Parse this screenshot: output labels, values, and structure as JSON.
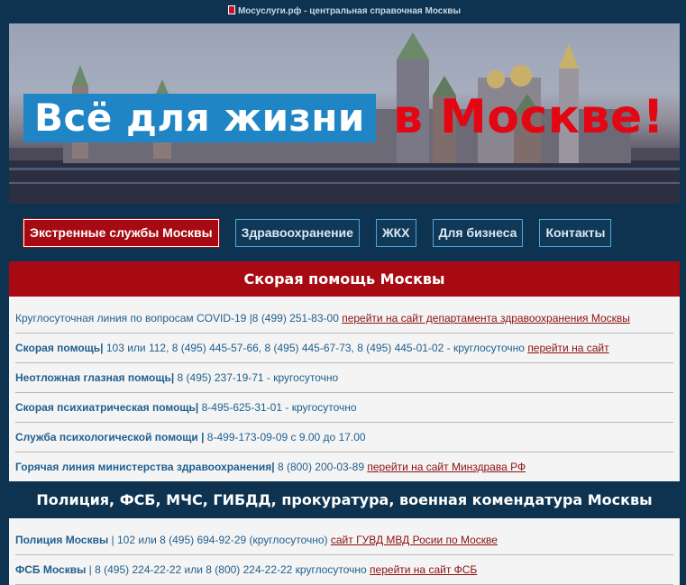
{
  "topbar": {
    "text": "Мосуслуги.рф - центральная справочная Москвы"
  },
  "hero": {
    "blue_text": "Всё для жизни",
    "red_text": "в Москве!"
  },
  "nav": [
    {
      "label": "Экстренные службы Москвы",
      "active": true
    },
    {
      "label": "Здравоохранение"
    },
    {
      "label": "ЖКХ"
    },
    {
      "label": "Для бизнеса"
    },
    {
      "label": "Контакты"
    }
  ],
  "sections": [
    {
      "title": "Скорая помощь Москвы",
      "rows": [
        {
          "name": "Круглосуточная линия по вопросам",
          "phone": " COVID-19 |8 (499) 251-83-00 ",
          "link": "перейти на сайт департамента здравоохранения Москвы"
        },
        {
          "name": "Скорая помощь|",
          "phone": " 103 или 112, 8 (495) 445-57-66, 8 (495) 445-67-73, 8 (495) 445-01-02 - круглосуточно ",
          "link": "перейти на сайт"
        },
        {
          "name": "Неотложная глазная помощь|",
          "phone": " 8 (495) 237-19-71 - кругосуточно",
          "link": ""
        },
        {
          "name": "Скорая психиатрическая помощь|",
          "phone": " 8-495-625-31-01 - кругосуточно",
          "link": ""
        },
        {
          "name": "Служба психологической помощи |",
          "phone": "  8-499-173-09-09 с 9.00 до 17.00",
          "link": ""
        },
        {
          "name": "Горячая линия министерства здравоохранения|",
          "phone": " 8 (800) 200-03-89 ",
          "link": "перейти на сайт Минздрава РФ"
        }
      ]
    },
    {
      "title": "Полиция, ФСБ, МЧС, ГИБДД, прокуратура, военная комендатура Москвы",
      "rows": [
        {
          "name": "Полиция Москвы",
          "phone": " | 102 или 8 (495) 694-92-29 (круглосуточно) ",
          "link": "сайт ГУВД МВД Росии по Москве"
        },
        {
          "name": "ФСБ Москвы",
          "phone": " | 8 (495) 224-22-22 или  8 (800) 224-22-22 круглосуточно ",
          "link": "перейти на сайт ФСБ"
        }
      ]
    }
  ],
  "colors": {
    "navy": "#0d3350",
    "red": "#a70a12",
    "blue": "#1f85c4",
    "hero_red": "#e30613",
    "link": "#8b1111"
  }
}
